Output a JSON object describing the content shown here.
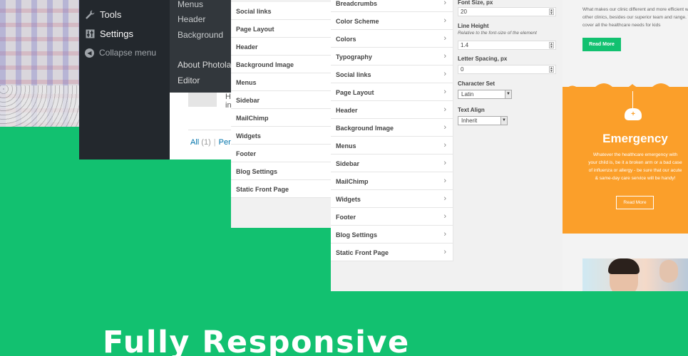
{
  "colors": {
    "green": "#12c170",
    "orange": "#fb9f2a",
    "wp_dark": "#23282d"
  },
  "wp_menu": {
    "items": [
      {
        "label": "Tools",
        "icon": "wrench-icon"
      },
      {
        "label": "Settings",
        "icon": "settings-icon"
      },
      {
        "label": "Collapse menu",
        "icon": "collapse-icon"
      }
    ]
  },
  "wp_submenu": {
    "items": [
      "Menus",
      "Header",
      "Background",
      "About Photolab",
      "Editor"
    ]
  },
  "wp_comments": {
    "stub_text": "H",
    "stub_text2": "in",
    "all_label": "All",
    "all_count": "(1)",
    "pending_label": "Per"
  },
  "customizer_back": {
    "items": [
      "Social links",
      "Page Layout",
      "Header",
      "Background Image",
      "Menus",
      "Sidebar",
      "MailChimp",
      "Widgets",
      "Footer",
      "Blog Settings",
      "Static Front Page"
    ]
  },
  "customizer_front": {
    "items": [
      "Breadcrumbs",
      "Color Scheme",
      "Colors",
      "Typography",
      "Social links",
      "Page Layout",
      "Header",
      "Background Image",
      "Menus",
      "Sidebar",
      "MailChimp",
      "Widgets",
      "Footer",
      "Blog Settings",
      "Static Front Page"
    ],
    "settings": {
      "font_size_label": "Font Size, px",
      "font_size_value": "20",
      "line_height_label": "Line Height",
      "line_height_note": "Relative to the font-size of the element",
      "line_height_value": "1.4",
      "letter_spacing_label": "Letter Spacing, px",
      "letter_spacing_value": "0",
      "charset_label": "Character Set",
      "charset_value": "Latin",
      "text_align_label": "Text Align",
      "text_align_value": "Inherit"
    }
  },
  "site_preview": {
    "intro": "What makes our clinic different and more efficient with other clinics, besides our superior team and range. We cover all the healthcare needs for kids",
    "read_more_1": "Read More",
    "emergency_title": "Emergency",
    "emergency_text": "Whatever the healthcare emergency with your child is, be it a broken arm or a bad case of influenza or allergy - be sure that our acute & same-day care service will be handy!",
    "read_more_2": "Read More"
  },
  "hero": {
    "title": "Fully Responsive"
  }
}
